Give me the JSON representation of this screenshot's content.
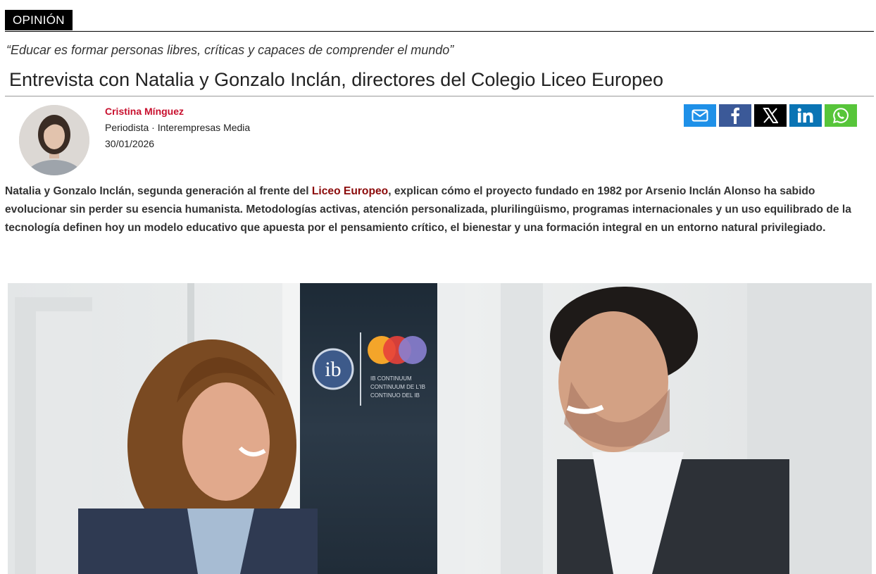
{
  "section": {
    "tag": "OPINIÓN"
  },
  "article": {
    "kicker": "“Educar es formar personas libres, críticas y capaces de comprender el mundo”",
    "title": "Entrevista con Natalia y Gonzalo Inclán, directores del Colegio Liceo Europeo",
    "lead_before": "Natalia y Gonzalo Inclán, segunda generación al frente del ",
    "lead_link": "Liceo Europeo",
    "lead_after": ", explican cómo el proyecto fundado en 1982 por Arsenio Inclán Alonso ha sabido evolucionar sin perder su esencia humanista. Metodologías activas, atención personalizada, plurilingüismo, programas internacionales y un uso equilibrado de la tecnología definen hoy un modelo educativo que apuesta por el pensamiento crítico, el bienestar y una formación integral en un entorno natural privilegiado."
  },
  "author": {
    "name": "Cristina Mínguez",
    "role": "Periodista · Interempresas Media",
    "date": "30/01/2026"
  },
  "share": [
    {
      "icon": "email-icon",
      "color": "#1e90e8"
    },
    {
      "icon": "facebook-icon",
      "color": "#3b5998"
    },
    {
      "icon": "x-icon",
      "color": "#000000"
    },
    {
      "icon": "linkedin-icon",
      "color": "#0a74b4"
    },
    {
      "icon": "whatsapp-icon",
      "color": "#57c53a"
    }
  ],
  "photo": {
    "logo_lines": [
      "IB CONTINUUM",
      "CONTINUUM DE L'IB",
      "CONTINUO DEL IB"
    ]
  },
  "colors": {
    "accent": "#c8102e",
    "link": "#8b0a0a"
  }
}
